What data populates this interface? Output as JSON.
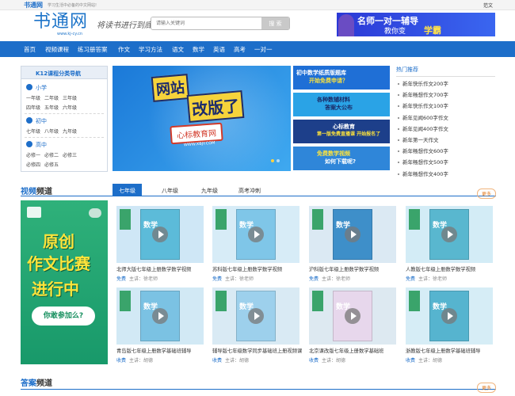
{
  "topbar": {
    "brand": "书通网",
    "slogan": "学习生活中必备的中文网站!",
    "right_link": "范文"
  },
  "header": {
    "logo_cn": "书通网",
    "logo_url": "www.kj-cy.cn",
    "motto": "将读书进行到底",
    "search_placeholder": "请输入关键词",
    "search_button": "搜 索",
    "ad": {
      "line1": "名师一对一辅导",
      "line2": "教你变",
      "line3": "学霸"
    }
  },
  "nav": [
    "首页",
    "视频课程",
    "练习册答案",
    "作文",
    "学习方法",
    "语文",
    "数学",
    "英语",
    "高考",
    "一对一"
  ],
  "k12": {
    "title": "K12课程分类导航",
    "sections": [
      {
        "name": "小学",
        "rows": [
          [
            "一年级",
            "二年级",
            "三年级"
          ],
          [
            "四年级",
            "五年级",
            "六年级"
          ]
        ]
      },
      {
        "name": "初中",
        "rows": [
          [
            "七年级",
            "八年级",
            "九年级"
          ]
        ]
      },
      {
        "name": "高中",
        "rows": [
          [
            "必修一",
            "必修二",
            "必修三"
          ],
          [
            "必修四",
            "必修五"
          ]
        ]
      }
    ]
  },
  "banner": {
    "line1": "网站",
    "line2": "改版了",
    "line3": "心标教育网",
    "url": "WWW.XBJY.COM"
  },
  "promos": [
    {
      "text1": "初中数学纸质版题库",
      "text2": "开始免费申请？",
      "bg": "#1f6fd6",
      "fg": "#ffffff"
    },
    {
      "text1": "各种数辅材料",
      "text2": "答案大公布",
      "bg": "#2aa3e6",
      "fg": "#1a2a66"
    },
    {
      "text1": "心标教育",
      "text2": "第一版免费直播课 开始报名了",
      "bg": "#1d3f8a",
      "fg": "#ffffff"
    },
    {
      "text1": "免费数学视频",
      "text2": "如何下载呢?",
      "bg": "#2f86d9",
      "fg": "#ffe43b"
    }
  ],
  "hot": {
    "title": "热门推荐",
    "items": [
      "新年快乐作文200字",
      "新年畅想作文700字",
      "新年快乐作文100字",
      "新年见闻600字作文",
      "新年见闻400字作文",
      "新年第一天作文",
      "新年畅想作文600字",
      "新年畅想作文500字",
      "新年畅想作文400字"
    ]
  },
  "video": {
    "title_a": "视频",
    "title_b": "频道",
    "tabs": [
      "七年级",
      "八年级",
      "九年级",
      "高考冲刺"
    ],
    "more": "更多",
    "contest": {
      "l1": "原创",
      "l2": "作文比赛",
      "l3": "进行中",
      "l4": "你敢参加么?"
    },
    "cards": [
      {
        "name": "北师大版七年级上册数学数学视频",
        "free": "免费",
        "teacher": "主讲：徐老师",
        "bg": "#cfe7f6",
        "book": "#5cbbd9",
        "book_title": "数学"
      },
      {
        "name": "苏科版七年级上册数学数学视频",
        "free": "免费",
        "teacher": "主讲：徐老师",
        "bg": "#d7ecf7",
        "book": "#7fc6e8",
        "book_title": "数学"
      },
      {
        "name": "沪科版七年级上册数学数学视频",
        "free": "免费",
        "teacher": "主讲：徐老师",
        "bg": "#dbe9f3",
        "book": "#3e8fc9",
        "book_title": "数学"
      },
      {
        "name": "人教版七年级上册数学数学视频",
        "free": "免费",
        "teacher": "主讲：徐老师",
        "bg": "#d3ecf6",
        "book": "#59b7cf",
        "book_title": "数学"
      },
      {
        "name": "青岛版七年级上册数学基础班辅导",
        "free": "收费",
        "teacher": "主讲：胡德",
        "bg": "#d2e9f5",
        "book": "#7bc2e3",
        "book_title": "数学"
      },
      {
        "name": "辅导版七年级数学同步基础班上册视频课",
        "free": "收费",
        "teacher": "主讲：胡德",
        "bg": "#d9eaf4",
        "book": "#9dd0ec",
        "book_title": "数学"
      },
      {
        "name": "北京课改版七年级上册数学基础班",
        "free": "收费",
        "teacher": "主讲：胡德",
        "bg": "#dde9f1",
        "book": "#e7d7ec",
        "book_title": "数学"
      },
      {
        "name": "浙教版七年级上册数学基础班辅导",
        "free": "收费",
        "teacher": "主讲：胡德",
        "bg": "#d6edf6",
        "book": "#56b4cf",
        "book_title": "数学"
      }
    ]
  },
  "answers": {
    "title_a": "答案",
    "title_b": "频道",
    "more": "更多"
  }
}
